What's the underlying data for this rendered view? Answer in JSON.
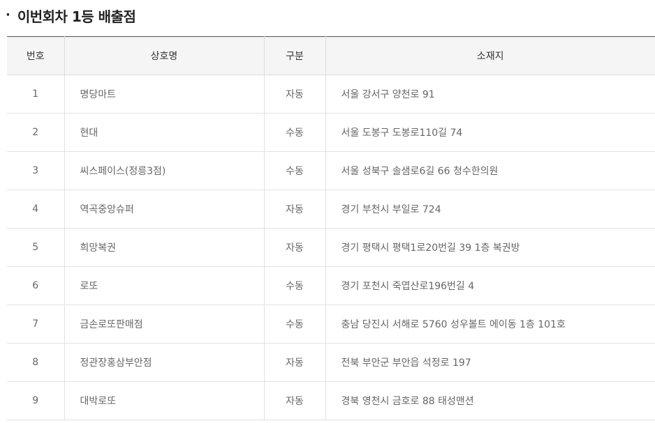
{
  "section": {
    "bullet": "·",
    "title": "이번회차 1등 배출점"
  },
  "table": {
    "headers": [
      "번호",
      "상호명",
      "구분",
      "소재지"
    ],
    "rows": [
      {
        "no": "1",
        "name": "명당마트",
        "type": "자동",
        "address": "서울 강서구 양천로 91"
      },
      {
        "no": "2",
        "name": "현대",
        "type": "수동",
        "address": "서울 도봉구 도봉로110길 74"
      },
      {
        "no": "3",
        "name": "씨스페이스(정릉3점)",
        "type": "수동",
        "address": "서울 성북구 솔샘로6길 66 청수한의원"
      },
      {
        "no": "4",
        "name": "역곡중앙슈퍼",
        "type": "자동",
        "address": "경기 부천시 부일로 724"
      },
      {
        "no": "5",
        "name": "희망복권",
        "type": "자동",
        "address": "경기 평택시 평택1로20번길 39 1층 복권방"
      },
      {
        "no": "6",
        "name": "로또",
        "type": "수동",
        "address": "경기 포천시 죽엽산로196번길 4"
      },
      {
        "no": "7",
        "name": "금손로또판매점",
        "type": "수동",
        "address": "충남 당진시 서해로 5760 성우볼트 에이동 1층 101호"
      },
      {
        "no": "8",
        "name": "정관장홍삼부안점",
        "type": "자동",
        "address": "전북 부안군 부안읍 석정로 197"
      },
      {
        "no": "9",
        "name": "대박로또",
        "type": "자동",
        "address": "경북 영천시 금호로 88 태성맨션"
      }
    ]
  }
}
